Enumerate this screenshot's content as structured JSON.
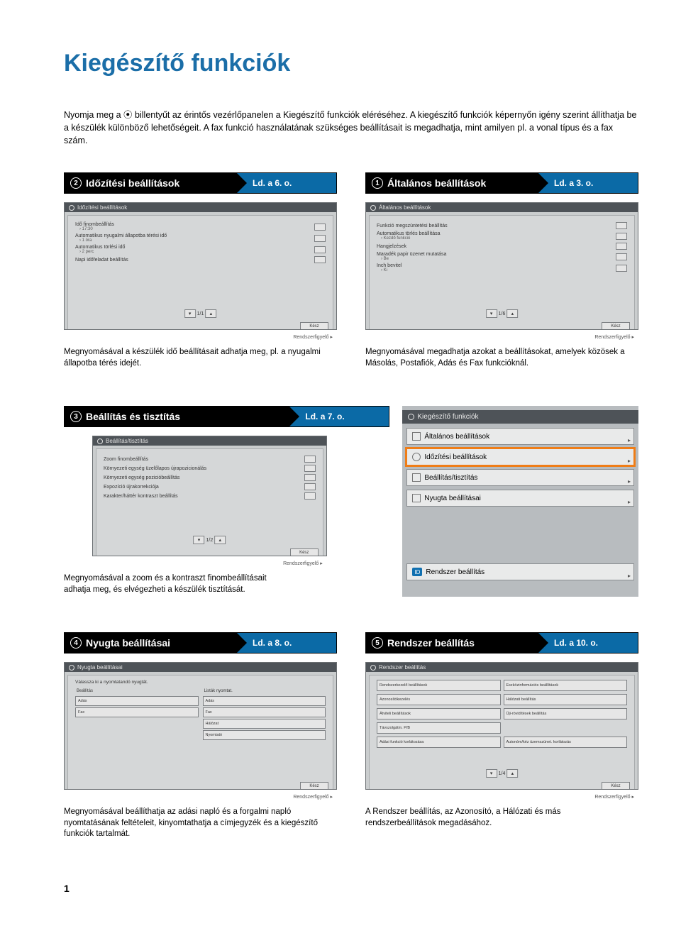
{
  "page_title": "Kiegészítő funkciók",
  "intro": "Nyomja meg a ⦿ billentyűt az érintős vezérlőpanelen a Kiegészítő funkciók eléréséhez. A kiegészítő funkciók képernyőn igény szerint állíthatja be a készülék különböző lehetőségeit. A fax funkció használatának szükséges beállításait is megadhatja, mint amilyen pl. a vonal típus és a fax szám.",
  "sections": {
    "s1": {
      "num": "1",
      "title": "Általános beállítások",
      "ref": "Ld. a 3. o.",
      "dlg_title": "Általános beállítások",
      "opts": [
        {
          "lbl": "Funkció megszüntetési beállítás",
          "sub": ""
        },
        {
          "lbl": "Automatikus törlés beállítása",
          "sub": "› Kezdő funkció"
        },
        {
          "lbl": "Hangjelzések",
          "sub": ""
        },
        {
          "lbl": "Maradék papir üzenet mutatása",
          "sub": "› Be"
        },
        {
          "lbl": "Inch bevitel",
          "sub": "› Ki"
        }
      ],
      "pager": "1/6",
      "close": "Kész",
      "footer": "Rendszerfigyelő ▸",
      "caption": "Megnyomásával megadhatja azokat a beállításokat, amelyek közösek a Másolás, Postafiók, Adás és Fax funkcióknál."
    },
    "s2": {
      "num": "2",
      "title": "Időzítési beállítások",
      "ref": "Ld. a 6. o.",
      "dlg_title": "Időzítési beállítások",
      "opts": [
        {
          "lbl": "Idő finombeállítás",
          "sub": "› 17:30"
        },
        {
          "lbl": "Automatikus nyugalmi állapotba térési idő",
          "sub": "› 1 óra"
        },
        {
          "lbl": "Automatikus törlési idő",
          "sub": "› 2 perc"
        },
        {
          "lbl": "Napi időfeladat beállítás",
          "sub": ""
        }
      ],
      "pager": "1/1",
      "close": "Kész",
      "footer": "Rendszerfigyelő ▸",
      "caption": "Megnyomásával a készülék idő beállításait adhatja meg, pl. a nyugalmi állapotba térés idejét."
    },
    "s3": {
      "num": "3",
      "title": "Beállítás és tisztítás",
      "ref": "Ld. a 7. o.",
      "dlg_title": "Beállítás/tisztítás",
      "opts": [
        {
          "lbl": "Zoom finombeállítás",
          "sub": ""
        },
        {
          "lbl": "Környezeti egység üzelőlapos újrapozicionálás",
          "sub": ""
        },
        {
          "lbl": "Környezeti egység pozicióbeállítás",
          "sub": ""
        },
        {
          "lbl": "Expozíció újrakorrekciója",
          "sub": ""
        },
        {
          "lbl": "Karakter/háttér kontraszt beállítás",
          "sub": ""
        }
      ],
      "pager": "1/2",
      "close": "Kész",
      "footer": "Rendszerfigyelő ▸",
      "caption": "Megnyomásával a zoom és a kontraszt finombeállításait adhatja meg, és elvégezheti a készülék tisztítását."
    },
    "s4": {
      "num": "4",
      "title": "Nyugta beállításai",
      "ref": "Ld. a 8. o.",
      "dlg_title": "Nyugta beállításai",
      "sub_title": "Válassza ki a nyomtatandó nyugtát.",
      "left_head": "Beállítás",
      "right_head": "Listák nyomtat.",
      "left_cells": [
        "Adás",
        "Fax"
      ],
      "right_cells": [
        "Adás",
        "Fax",
        "Hálózat",
        "Nyomtató"
      ],
      "footer": "Rendszerfigyelő ▸",
      "close": "Kész",
      "caption": "Megnyomásával beállíthatja az adási napló és a forgalmi napló nyomtatásának feltételeit, kinyomtathatja a címjegyzék és a kiegészítő funkciók tartalmát."
    },
    "s5": {
      "num": "5",
      "title": "Rendszer beállítás",
      "ref": "Ld. a 10. o.",
      "dlg_title": "Rendszer beállítás",
      "grid": [
        "Rendszerkezelő beállítások",
        "Eszközinformációs beállítások",
        "Azonosítókezelés",
        "Hálózati beállítás",
        "Átviteli beállítások",
        "Üji-rövidítések beállítás",
        "Távszolgátm. P/B",
        "",
        "Adási funkció korlátozása",
        "Autonóm/kéz üzemszünet. korlátozás"
      ],
      "pager": "1/4",
      "close": "Kész",
      "footer": "Rendszerfigyelő ▸",
      "caption": "A Rendszer beállítás, az Azonosító, a Hálózati és más rendszerbeállítások megadásához."
    }
  },
  "side_panel": {
    "title": "Kiegészítő funkciók",
    "buttons": [
      "Általános beállítások",
      "Időzítési beállítások",
      "Beállítás/tisztítás",
      "Nyugta beállításai"
    ],
    "last": "Rendszer beállítás",
    "last_icon_text": "ID"
  },
  "page_number": "1"
}
